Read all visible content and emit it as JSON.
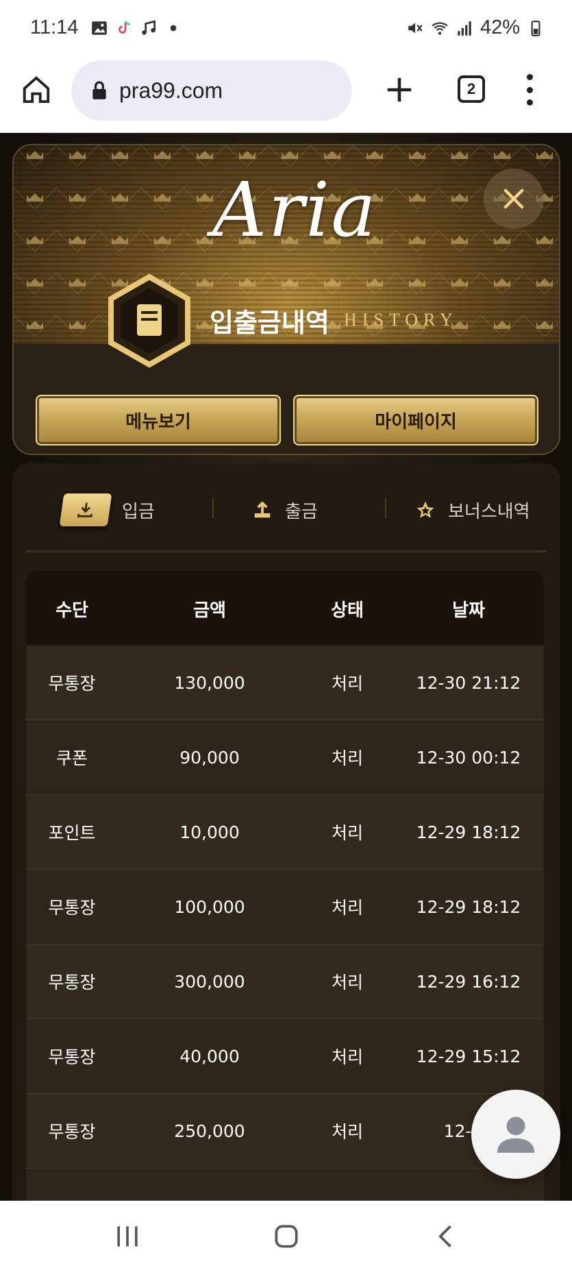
{
  "status_bar": {
    "time": "11:14",
    "battery": "42%"
  },
  "browser": {
    "url": "pra99.com",
    "tab_count": "2"
  },
  "header": {
    "logo": "Aria",
    "title_kr": "입출금내역",
    "title_en": "HISTORY",
    "menu_button": "메뉴보기",
    "mypage_button": "마이페이지"
  },
  "tabs": {
    "deposit": "입금",
    "withdraw": "출금",
    "bonus": "보너스내역"
  },
  "table": {
    "headers": [
      "수단",
      "금액",
      "상태",
      "날짜"
    ],
    "rows": [
      [
        "무통장",
        "130,000",
        "처리",
        "12-30 21:12"
      ],
      [
        "쿠폰",
        "90,000",
        "처리",
        "12-30 00:12"
      ],
      [
        "포인트",
        "10,000",
        "처리",
        "12-29 18:12"
      ],
      [
        "무통장",
        "100,000",
        "처리",
        "12-29 18:12"
      ],
      [
        "무통장",
        "300,000",
        "처리",
        "12-29 16:12"
      ],
      [
        "무통장",
        "40,000",
        "처리",
        "12-29 15:12"
      ],
      [
        "무통장",
        "250,000",
        "처리",
        "12-29"
      ]
    ]
  },
  "colors": {
    "gold": "#c9a85a",
    "dark_bg": "#15110b",
    "row_bg": "#33291d"
  },
  "icons": [
    "home-icon",
    "lock-icon",
    "plus-icon",
    "kebab-icon",
    "close-icon",
    "book-icon",
    "download-icon",
    "upload-icon",
    "star-icon",
    "person-icon"
  ]
}
